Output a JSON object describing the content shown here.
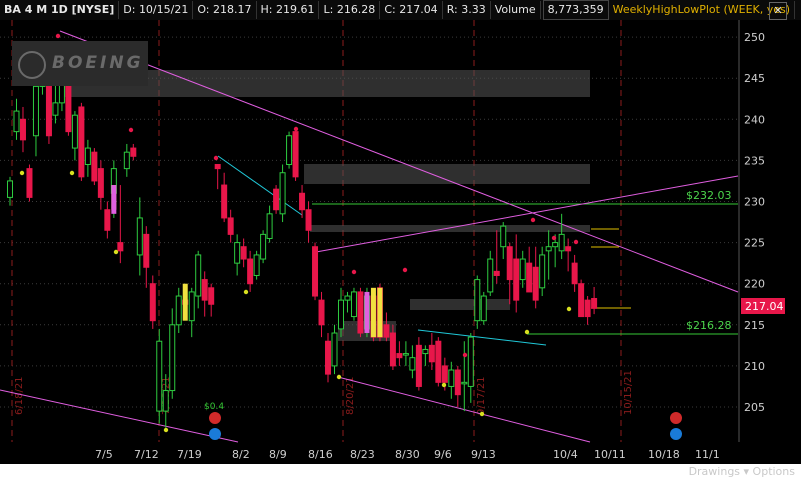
{
  "header": {
    "symbol_label": "BA 4 M 1D [NYSE]",
    "date": "D: 10/15/21",
    "open": "O: 218.17",
    "high": "H: 219.61",
    "low": "L: 216.28",
    "close": "C: 217.04",
    "range": "R: 3.33",
    "volume_label": "Volume",
    "volume_value": "8,773,359",
    "study_label": "WeeklyHighLowPlot (WEEK, yes)",
    "close_icon": "x-icon"
  },
  "footer": {
    "faint_text": "Drawings ▾  Options"
  },
  "chart_data": {
    "type": "candlestick",
    "ylim": [
      201,
      251.5
    ],
    "y_ticks": [
      205,
      210,
      215,
      220,
      225,
      230,
      235,
      240,
      245,
      250
    ],
    "x_ticks": [
      "7/5",
      "7/12",
      "7/19",
      "8/2",
      "8/9",
      "8/16",
      "8/23",
      "8/30",
      "9/6",
      "9/13",
      "10/4",
      "10/11",
      "10/18",
      "11/1"
    ],
    "current_price_label": "217.04",
    "level_labels": [
      {
        "label": "$232.03",
        "value": 229.9,
        "color": "#4cd44c"
      },
      {
        "label": "$216.28",
        "value": 213.8,
        "color": "#4cd44c"
      }
    ],
    "event_label": "$0.4",
    "vertical_date_labels": [
      "6/18/21",
      "7/16/21",
      "8/20/21",
      "9/17/21",
      "10/15/21"
    ],
    "logo_text": "BOEING",
    "colors": {
      "up": "#2ecc40",
      "down": "#e8174a",
      "trendline": "#e05ee0",
      "channel": "#20c8d8",
      "bg": "#000000"
    },
    "candles": [
      [
        230.5,
        232.5,
        229.5,
        233.0
      ],
      [
        238.5,
        241.0,
        237.5,
        242.5
      ],
      [
        240.0,
        237.5,
        236.0,
        241.5
      ],
      [
        234.0,
        230.5,
        230.0,
        234.5
      ],
      [
        238.0,
        244.0,
        235.5,
        245.5
      ],
      [
        244.0,
        246.5,
        243.0,
        247.5
      ],
      [
        244.0,
        238.0,
        237.0,
        245.5
      ],
      [
        240.5,
        242.0,
        239.5,
        244.5
      ],
      [
        242.0,
        248.0,
        241.0,
        249.5
      ],
      [
        248.0,
        238.5,
        238.0,
        248.5
      ],
      [
        236.5,
        240.5,
        235.0,
        241.0
      ],
      [
        241.5,
        233.0,
        232.5,
        242.0
      ],
      [
        234.5,
        236.5,
        233.0,
        237.5
      ],
      [
        236.0,
        232.5,
        232.0,
        236.5
      ],
      [
        234.0,
        230.5,
        229.0,
        235.0
      ],
      [
        229.0,
        226.5,
        225.5,
        230.0
      ],
      [
        231.0,
        234.0,
        228.0,
        235.0
      ],
      [
        225.0,
        224.0,
        222.5,
        232.0
      ],
      [
        234.0,
        236.0,
        233.0,
        237.0
      ],
      [
        236.5,
        235.5,
        235.0,
        237.0
      ],
      [
        223.5,
        228.0,
        221.0,
        230.5
      ],
      [
        226.0,
        222.0,
        219.5,
        227.0
      ],
      [
        220.0,
        215.5,
        214.5,
        221.0
      ],
      [
        204.5,
        213.0,
        203.0,
        214.5
      ],
      [
        204.5,
        207.0,
        202.5,
        209.0
      ],
      [
        207.0,
        215.0,
        206.0,
        217.0
      ],
      [
        215.0,
        218.5,
        214.0,
        219.5
      ],
      [
        218.0,
        217.5,
        216.0,
        219.0
      ],
      [
        215.5,
        219.0,
        213.5,
        219.5
      ],
      [
        218.5,
        223.5,
        217.0,
        224.0
      ],
      [
        220.5,
        218.0,
        216.0,
        221.5
      ],
      [
        219.5,
        217.5,
        216.0,
        220.0
      ],
      [
        234.5,
        234.0,
        231.5,
        234.5
      ],
      [
        232.0,
        228.0,
        227.5,
        233.5
      ],
      [
        228.0,
        226.0,
        225.0,
        229.0
      ],
      [
        222.5,
        225.0,
        221.0,
        226.0
      ],
      [
        224.5,
        223.0,
        222.0,
        225.5
      ],
      [
        223.0,
        220.0,
        219.0,
        224.0
      ],
      [
        221.0,
        223.5,
        220.5,
        224.0
      ],
      [
        223.0,
        226.0,
        222.5,
        226.5
      ],
      [
        225.5,
        228.5,
        225.0,
        229.5
      ],
      [
        231.5,
        229.0,
        228.5,
        232.0
      ],
      [
        228.5,
        233.5,
        227.5,
        234.5
      ],
      [
        234.5,
        238.0,
        234.0,
        238.5
      ],
      [
        238.5,
        233.0,
        232.5,
        239.0
      ],
      [
        231.0,
        229.0,
        228.0,
        232.0
      ],
      [
        229.0,
        226.5,
        225.0,
        230.0
      ],
      [
        224.5,
        218.5,
        218.0,
        225.0
      ],
      [
        218.0,
        215.0,
        213.5,
        219.0
      ],
      [
        213.0,
        209.0,
        208.0,
        214.0
      ],
      [
        210.0,
        214.0,
        209.0,
        215.0
      ],
      [
        214.5,
        218.0,
        213.5,
        219.5
      ],
      [
        218.0,
        218.5,
        216.5,
        219.0
      ],
      [
        216.0,
        219.0,
        215.5,
        219.5
      ],
      [
        219.0,
        214.0,
        213.5,
        219.5
      ],
      [
        214.5,
        218.5,
        213.5,
        219.5
      ],
      [
        218.5,
        213.5,
        213.0,
        219.0
      ],
      [
        219.5,
        213.5,
        213.0,
        220.0
      ],
      [
        215.0,
        213.5,
        213.0,
        216.5
      ],
      [
        214.0,
        210.0,
        209.5,
        215.0
      ],
      [
        211.5,
        211.0,
        210.0,
        213.0
      ],
      [
        211.5,
        211.5,
        210.0,
        213.0
      ],
      [
        209.5,
        211.0,
        208.5,
        212.5
      ],
      [
        212.5,
        207.5,
        207.0,
        213.5
      ],
      [
        211.5,
        212.0,
        210.0,
        212.5
      ],
      [
        212.5,
        210.5,
        209.5,
        214.0
      ],
      [
        213.0,
        208.0,
        207.5,
        213.5
      ],
      [
        210.0,
        208.0,
        207.0,
        211.0
      ],
      [
        207.5,
        209.5,
        206.0,
        210.5
      ],
      [
        209.5,
        206.5,
        205.0,
        210.0
      ],
      [
        208.0,
        208.0,
        204.5,
        213.0
      ],
      [
        207.5,
        213.5,
        205.5,
        214.0
      ],
      [
        215.5,
        220.5,
        214.5,
        221.0
      ],
      [
        215.5,
        218.5,
        215.0,
        219.0
      ],
      [
        219.0,
        223.0,
        218.5,
        224.0
      ],
      [
        221.5,
        221.0,
        220.0,
        226.5
      ],
      [
        224.5,
        227.0,
        223.0,
        227.5
      ],
      [
        224.5,
        220.5,
        217.5,
        225.0
      ],
      [
        223.0,
        218.0,
        216.5,
        226.0
      ],
      [
        220.5,
        223.0,
        219.5,
        224.0
      ],
      [
        222.5,
        219.0,
        219.0,
        224.5
      ],
      [
        222.0,
        218.0,
        217.0,
        224.5
      ],
      [
        219.5,
        223.5,
        218.5,
        224.5
      ],
      [
        224.0,
        224.5,
        220.5,
        226.5
      ],
      [
        224.5,
        225.0,
        222.0,
        226.0
      ],
      [
        224.0,
        226.0,
        223.0,
        228.5
      ],
      [
        224.5,
        224.0,
        221.5,
        225.5
      ],
      [
        222.5,
        220.0,
        219.0,
        223.5
      ],
      [
        220.0,
        216.0,
        216.0,
        220.5
      ],
      [
        218.0,
        216.0,
        215.0,
        218.5
      ],
      [
        218.2,
        217.0,
        216.3,
        219.6
      ]
    ]
  }
}
